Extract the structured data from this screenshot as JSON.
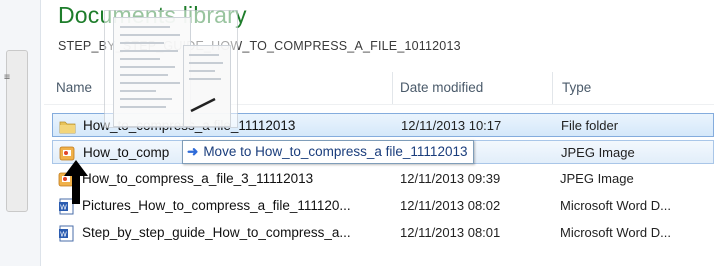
{
  "library": {
    "title": "Documents library",
    "path": "STEP_BY_STEP_GUIDE_HOW_TO_COMPRESS_A_FILE_10112013"
  },
  "columns": {
    "name": "Name",
    "date": "Date modified",
    "type": "Type"
  },
  "files": [
    {
      "name": "How_to_compress_a file_11112013",
      "date": "12/11/2013 10:17",
      "type": "File folder",
      "icon": "folder-icon"
    },
    {
      "name": "How_to_comp",
      "date": "",
      "type": "JPEG Image",
      "icon": "jpeg-image-icon"
    },
    {
      "name": "How_to_compress_a_file_3_11112013",
      "date": "12/11/2013 09:39",
      "type": "JPEG Image",
      "icon": "jpeg-image-icon"
    },
    {
      "name": "Pictures_How_to_compress_a_file_111120...",
      "date": "12/11/2013 08:02",
      "type": "Microsoft Word D...",
      "icon": "word-document-icon"
    },
    {
      "name": "Step_by_step_guide_How_to_compress_a...",
      "date": "12/11/2013 08:01",
      "type": "Microsoft Word D...",
      "icon": "word-document-icon"
    }
  ],
  "drop_tooltip": {
    "icon": "arrow-right-icon",
    "text": "Move to How_to_compress_a file_11112013"
  },
  "splitter": {
    "grip": "≡"
  },
  "colors": {
    "library_title": "#1e7d2b",
    "selection_border": "#84acdd",
    "tooltip_text": "#1a3d7c"
  }
}
